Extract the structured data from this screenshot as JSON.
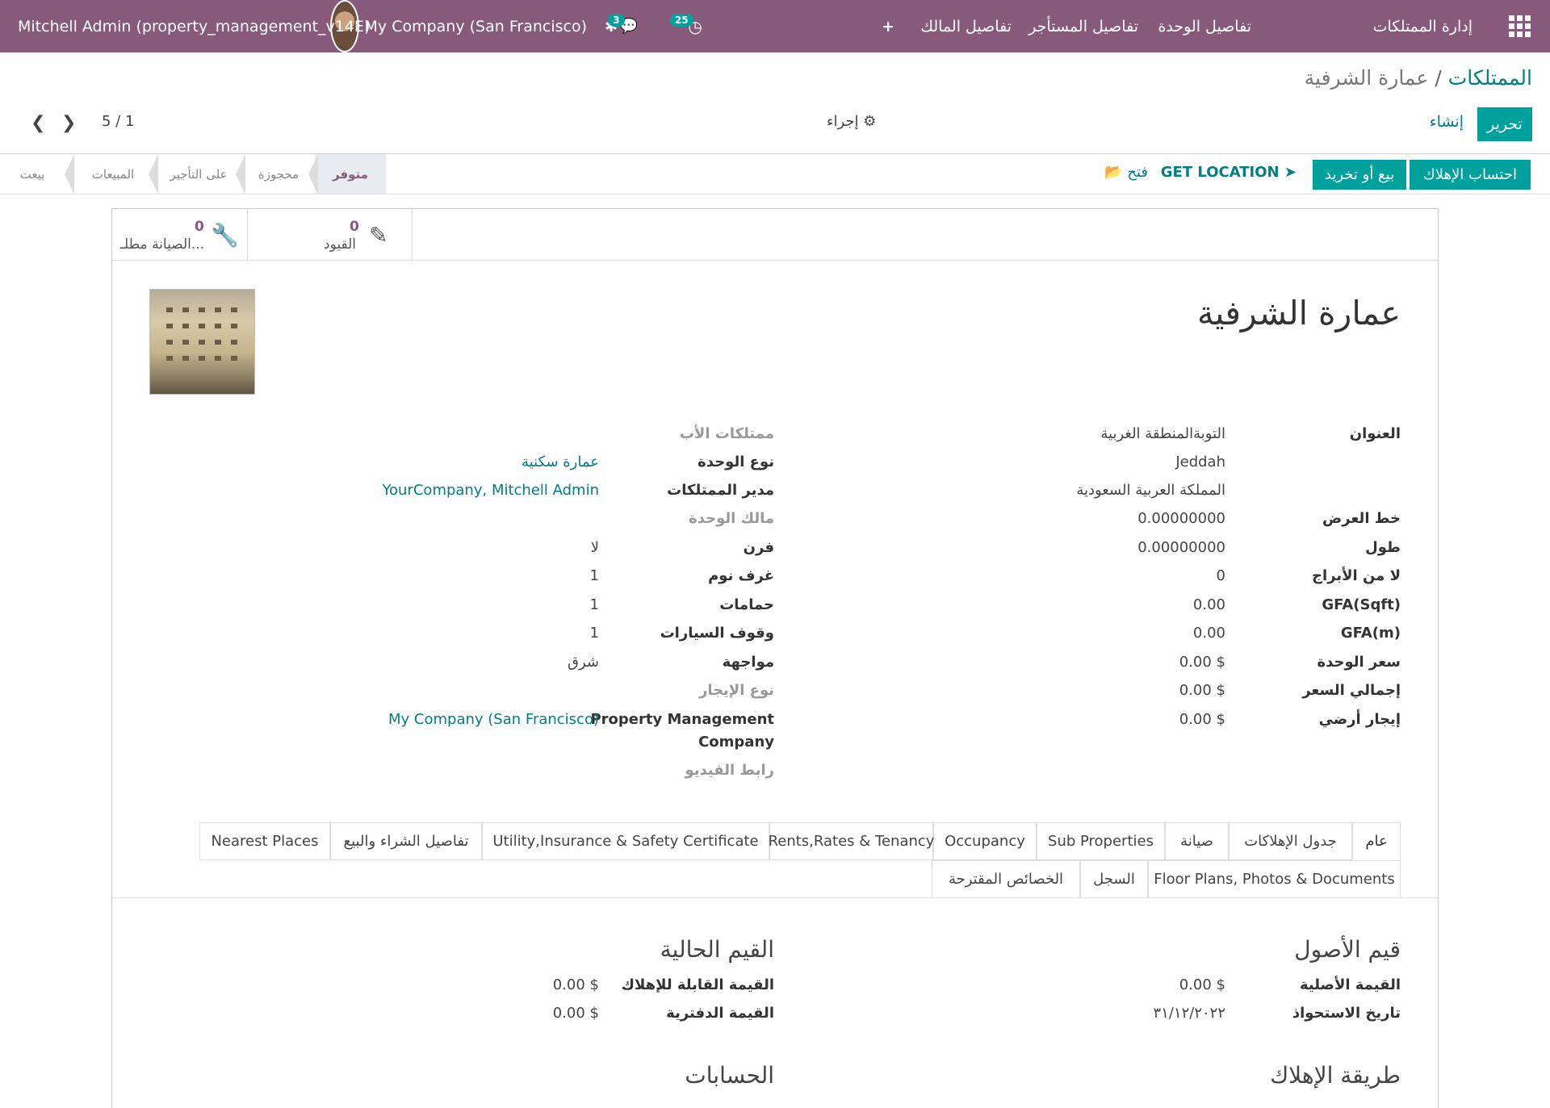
{
  "navbar": {
    "brand": "إدارة الممتلكات",
    "menu": [
      "تفاصيل الوحدة",
      "تفاصيل المستأجر",
      "تفاصيل المالك"
    ],
    "plus": "+",
    "activity_count": "25",
    "message_count": "3",
    "company": "My Company (San Francisco)",
    "user": "Mitchell Admin (property_management_v14E)"
  },
  "breadcrumb": {
    "parent": "الممتلكات",
    "separator": "/",
    "current": "عمارة الشرفية"
  },
  "controls": {
    "edit": "تحرير",
    "create": "إنشاء",
    "action": "إجراء",
    "pager": "5 / 1"
  },
  "header": {
    "buttons": [
      "احتساب الإهلاك",
      "بيع أو تخريد"
    ],
    "get_location": "GET LOCATION",
    "open": "فتح",
    "stages": [
      "متوفر",
      "محجوزة",
      "على التأجير",
      "المبيعات",
      "بيعت"
    ]
  },
  "smart_buttons": [
    {
      "count": "0",
      "label": "القيود"
    },
    {
      "count": "0",
      "label": "الصيانة مطلـ..."
    }
  ],
  "record": {
    "title": "عمارة الشرفية",
    "left_fields": [
      {
        "label": "العنوان",
        "value": "التوبةالمنطقة الغربية"
      },
      {
        "label": "",
        "value": "Jeddah"
      },
      {
        "label": "",
        "value": "المملكة العربية السعودية"
      },
      {
        "label": "خط العرض",
        "value": "0.00000000"
      },
      {
        "label": "طول",
        "value": "0.00000000"
      },
      {
        "label": "لا من الأبراج",
        "value": "0"
      },
      {
        "label": "GFA(Sqft)",
        "value": "0.00"
      },
      {
        "label": "GFA(m)",
        "value": "0.00"
      },
      {
        "label": "سعر الوحدة",
        "value": "0.00 $"
      },
      {
        "label": "إجمالي السعر",
        "value": "0.00 $"
      },
      {
        "label": "إيجار أرضي",
        "value": "0.00 $"
      }
    ],
    "right_fields": [
      {
        "label": "ممتلكات الأب",
        "value": ""
      },
      {
        "label": "نوع الوحدة",
        "value": "عمارة سكنية"
      },
      {
        "label": "مدير الممتلكات",
        "value": "YourCompany, Mitchell Admin"
      },
      {
        "label": "مالك الوحدة",
        "value": ""
      },
      {
        "label": "فرن",
        "value": "لا"
      },
      {
        "label": "غرف نوم",
        "value": "1"
      },
      {
        "label": "حمامات",
        "value": "1"
      },
      {
        "label": "وقوف السيارات",
        "value": "1"
      },
      {
        "label": "مواجهة",
        "value": "شرق"
      },
      {
        "label": "نوع الإيجار",
        "value": ""
      },
      {
        "label": "Property Management",
        "label2": "Company",
        "value": "My Company (San Francisco)"
      },
      {
        "label": "رابط الفيديو",
        "value": ""
      }
    ]
  },
  "tabs": {
    "row1": [
      "عام",
      "جدول الإهلاكات",
      "صيانة",
      "Sub Properties",
      "Occupancy",
      "Rents,Rates & Tenancy",
      "Utility,Insurance & Safety Certificate",
      "تفاصيل الشراء والبيع",
      "Nearest Places"
    ],
    "row2": [
      "Floor Plans, Photos & Documents",
      "السجل",
      "الخصائص المقترحة"
    ]
  },
  "general_tab": {
    "asset_values": {
      "title": "قيم الأصول",
      "fields": [
        {
          "label": "القيمة الأصلية",
          "value": "0.00 $"
        },
        {
          "label": "تاريخ الاستحواذ",
          "value": "٣١/١٢/٢٠٢٢"
        }
      ]
    },
    "current_values": {
      "title": "القيم الحالية",
      "fields": [
        {
          "label": "القيمة القابلة للإهلاك",
          "value": "0.00 $"
        },
        {
          "label": "القيمة الدفترية",
          "value": "0.00 $"
        }
      ]
    },
    "depreciation_method": {
      "title": "طريقة الإهلاك"
    },
    "accounts": {
      "title": "الحسابات"
    }
  },
  "colors": {
    "navbar": "#875a7b",
    "primary": "#00a09d",
    "link": "#017e84"
  }
}
